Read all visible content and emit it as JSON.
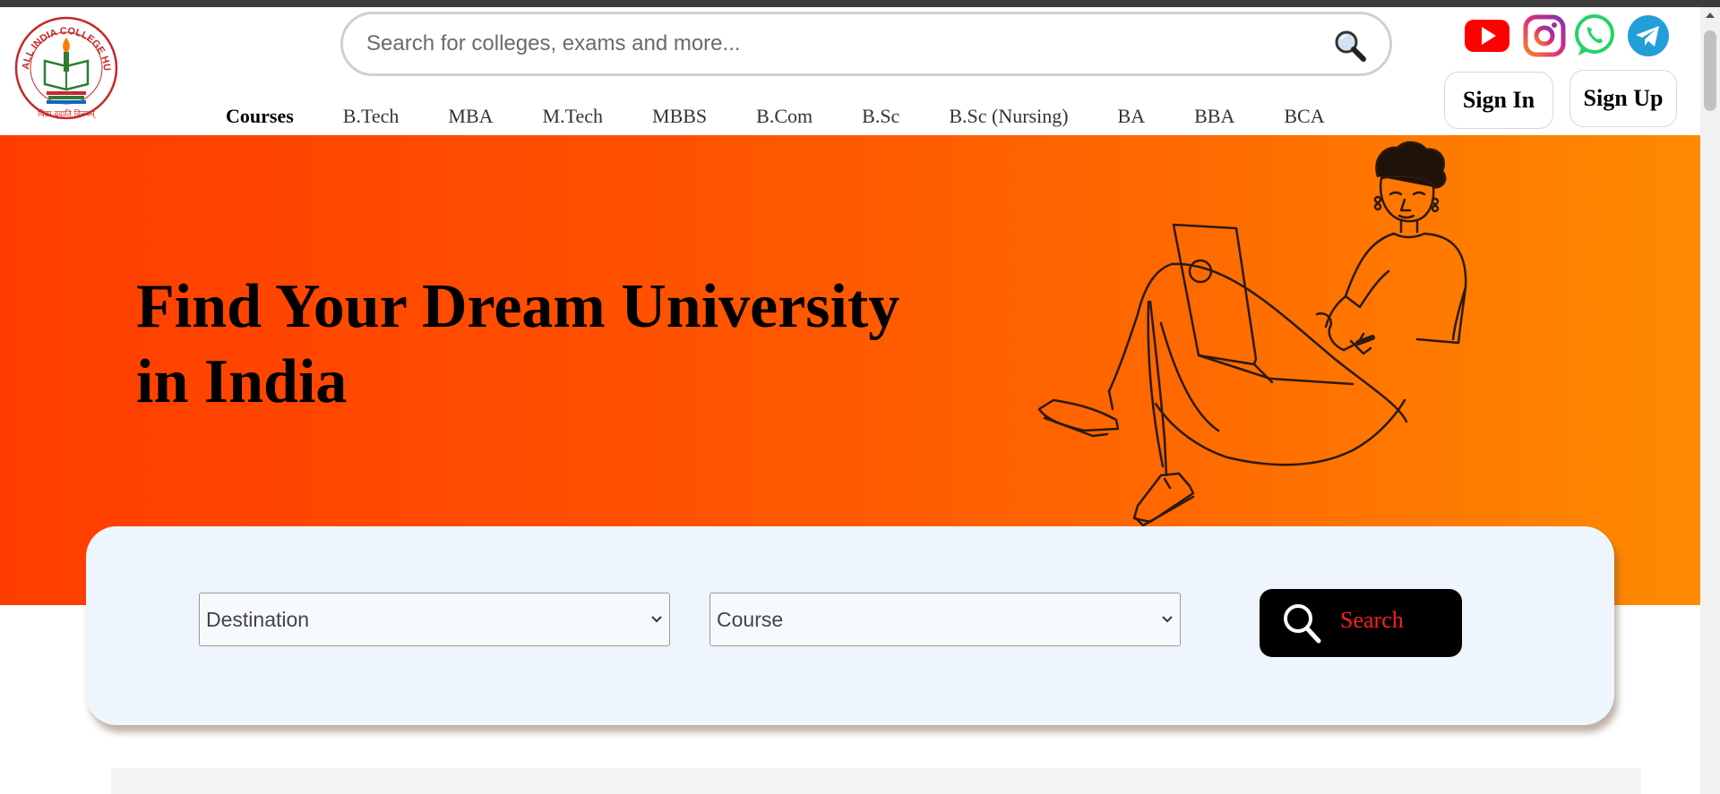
{
  "header": {
    "logo": {
      "arc_text": "ALL INDIA COLLEGE HUB",
      "motto": "विद्या ददाति विनयम्"
    },
    "search": {
      "placeholder": "Search for colleges, exams and more...",
      "icon": "search-icon"
    },
    "social": [
      {
        "name": "YouTube",
        "icon": "youtube-icon",
        "color": "#ff0000"
      },
      {
        "name": "Instagram",
        "icon": "instagram-icon",
        "color": "#c13584"
      },
      {
        "name": "WhatsApp",
        "icon": "whatsapp-icon",
        "color": "#25d366"
      },
      {
        "name": "Telegram",
        "icon": "telegram-icon",
        "color": "#229ed9"
      }
    ],
    "nav": [
      "Courses",
      "B.Tech",
      "MBA",
      "M.Tech",
      "MBBS",
      "B.Com",
      "B.Sc",
      "B.Sc (Nursing)",
      "BA",
      "BBA",
      "BCA"
    ],
    "signin_label": "Sign In",
    "signup_label": "Sign Up"
  },
  "hero": {
    "title_line1": "Find Your Dream University",
    "title_line2": "in India",
    "gradient_start": "#ff3d00",
    "gradient_end": "#ff8a00"
  },
  "finder": {
    "destination_value": "Destination",
    "course_value": "Course",
    "search_label": "Search",
    "search_label_color": "#ff2020"
  }
}
